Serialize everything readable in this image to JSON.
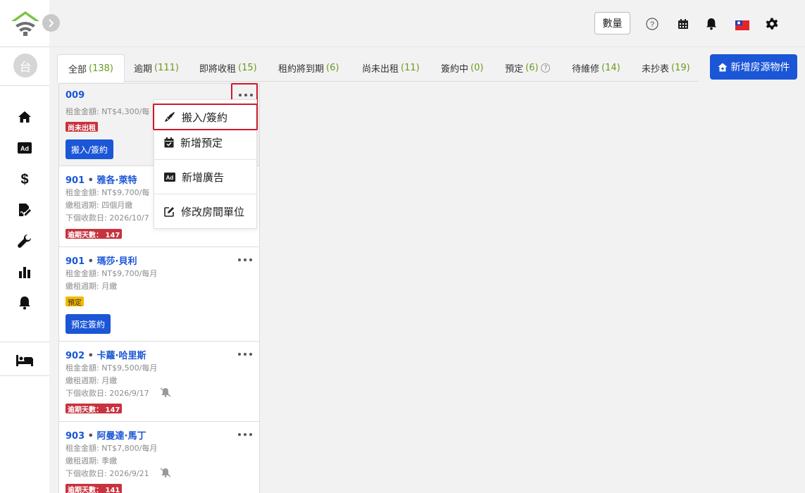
{
  "sidebar": {
    "avatar_text": "台"
  },
  "header": {
    "qty_label": "數量",
    "help_icon": "question-circle-icon",
    "flag_icon": "taiwan-flag-icon"
  },
  "tabs": [
    {
      "label": "全部",
      "count": "(138)"
    },
    {
      "label": "逾期",
      "count": "(111)"
    },
    {
      "label": "即將收租",
      "count": "(15)"
    },
    {
      "label": "租約將到期",
      "count": "(6)"
    },
    {
      "label": "尚未出租",
      "count": "(11)"
    },
    {
      "label": "簽約中",
      "count": "(0)"
    },
    {
      "label": "預定",
      "count": "(6)"
    },
    {
      "label": "待維修",
      "count": "(14)"
    },
    {
      "label": "未抄表",
      "count": "(19)"
    }
  ],
  "add_property_label": "新增房源物件",
  "cards": [
    {
      "room": "009",
      "tenant": "",
      "rent": "租金金額: NT$4,300/每",
      "badge": "尚未出租",
      "button": "搬入/簽約"
    },
    {
      "room": "901",
      "tenant": "雅各·萊特",
      "rent": "租金金額: NT$9,700/每",
      "cycle": "繳租週期: 四個月繳",
      "next": "下個收款日:  2026/10/7",
      "badge": "逾期天數： 147"
    },
    {
      "room": "901",
      "tenant": "瑪莎·貝利",
      "rent": "租金金額: NT$9,700/每月",
      "cycle": "繳租週期: 月繳",
      "badge": "預定",
      "button": "預定簽約"
    },
    {
      "room": "902",
      "tenant": "卡蘿·哈里斯",
      "rent": "租金金額: NT$9,500/每月",
      "cycle": "繳租週期: 月繳",
      "next": "下個收款日:  2026/9/17",
      "badge": "逾期天數： 147"
    },
    {
      "room": "903",
      "tenant": "阿曼達·馬丁",
      "rent": "租金金額: NT$7,800/每月",
      "cycle": "繳租週期: 季繳",
      "next": "下個收款日:  2026/9/21",
      "badge": "逾期天數： 141"
    }
  ],
  "menu": {
    "items": [
      {
        "label": "搬入/簽約",
        "icon": "pen-icon"
      },
      {
        "label": "新增預定",
        "icon": "calendar-check-icon"
      },
      {
        "label": "新增廣告",
        "icon": "ad-icon"
      },
      {
        "label": "修改房間單位",
        "icon": "edit-icon"
      }
    ]
  },
  "colors": {
    "primary": "#1a56d6",
    "danger": "#c8323e",
    "warning": "#f5b800",
    "count_green": "#6a9a1c",
    "highlight": "#d0172a"
  }
}
